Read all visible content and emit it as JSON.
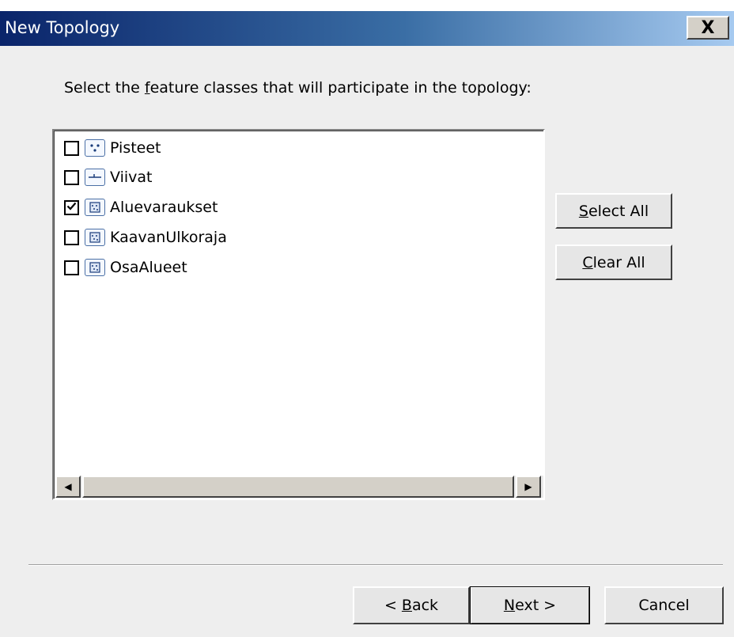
{
  "window": {
    "title": "New Topology",
    "close_label": "X"
  },
  "instruction": {
    "before": "Select the ",
    "mnemonic": "f",
    "after": "eature classes that will participate in the topology:"
  },
  "feature_classes": [
    {
      "label": "Pisteet",
      "checked": false,
      "icon": "point-feature-icon"
    },
    {
      "label": "Viivat",
      "checked": false,
      "icon": "line-feature-icon"
    },
    {
      "label": "Aluevaraukset",
      "checked": true,
      "icon": "polygon-feature-icon"
    },
    {
      "label": "KaavanUlkoraja",
      "checked": false,
      "icon": "polygon-feature-icon"
    },
    {
      "label": "OsaAlueet",
      "checked": false,
      "icon": "polygon-feature-icon"
    }
  ],
  "buttons": {
    "select_all": {
      "mnemonic": "S",
      "rest": "elect All"
    },
    "clear_all": {
      "mnemonic": "C",
      "rest": "lear All"
    },
    "back": {
      "prefix": "< ",
      "mnemonic": "B",
      "rest": "ack"
    },
    "next": {
      "mnemonic": "N",
      "rest": "ext >"
    },
    "cancel": "Cancel"
  },
  "scrollbar": {
    "left_arrow": "◀",
    "right_arrow": "▶"
  }
}
